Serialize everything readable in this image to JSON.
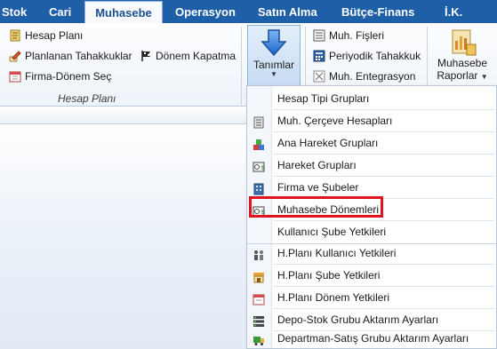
{
  "tabs": [
    {
      "label": "Stok"
    },
    {
      "label": "Cari"
    },
    {
      "label": "Muhasebe"
    },
    {
      "label": "Operasyon"
    },
    {
      "label": "Satın Alma"
    },
    {
      "label": "Bütçe-Finans"
    },
    {
      "label": "İ.K."
    }
  ],
  "active_tab": "Muhasebe",
  "ribbon": {
    "group_hesap_plani": {
      "items": [
        {
          "label": "Hesap Planı",
          "icon": "notebook-icon"
        },
        {
          "label": "Planlanan Tahakkuklar",
          "icon": "pencil-edit-icon"
        },
        {
          "label": "Dönem Kapatma",
          "icon": "flag-icon"
        },
        {
          "label": "Firma-Dönem Seç",
          "icon": "calendar-icon"
        }
      ],
      "group_label": "Hesap Planı"
    },
    "tanimlar": {
      "label": "Tanımlar",
      "icon": "down-arrow-icon"
    },
    "group_fis": {
      "items": [
        {
          "label": "Muh. Fişleri",
          "icon": "document-list-icon"
        },
        {
          "label": "Periyodik Tahakkuk",
          "icon": "calculator-icon"
        },
        {
          "label": "Muh. Entegrasyon",
          "icon": "integration-icon"
        }
      ]
    },
    "raporlar": {
      "label_line1": "Muhasebe",
      "label_line2": "Raporlar",
      "icon": "report-chart-icon"
    }
  },
  "menu": {
    "items": [
      {
        "label": "Hesap Tipi Grupları",
        "icon": ""
      },
      {
        "label": "Muh. Çerçeve Hesapları",
        "icon": "ledger-icon"
      },
      {
        "label": "Ana Hareket Grupları",
        "icon": "blocks-icon"
      },
      {
        "label": "Hareket Grupları",
        "icon": "money-card-icon"
      },
      {
        "label": "Firma ve Şubeler",
        "icon": "building-icon"
      },
      {
        "label": "Muhasebe Dönemleri",
        "icon": "money-card-icon"
      },
      {
        "label": "Kullanıcı Şube Yetkileri",
        "icon": ""
      },
      {
        "label": "H.Planı Kullanıcı Yetkileri",
        "icon": "users-icon"
      },
      {
        "label": "H.Planı Şube Yetkileri",
        "icon": "store-icon"
      },
      {
        "label": "H.Planı Dönem Yetkileri",
        "icon": "calendar-icon"
      },
      {
        "label": "Depo-Stok Grubu Aktarım Ayarları",
        "icon": "server-icon"
      },
      {
        "label": "Departman-Satış Grubu Aktarım Ayarları",
        "icon": "truck-icon"
      }
    ],
    "highlighted": "Muhasebe Dönemleri"
  },
  "colors": {
    "tabbar": "#1e5fa8",
    "active_tab_text": "#1c4f8f",
    "highlight_border": "#e0141e"
  }
}
